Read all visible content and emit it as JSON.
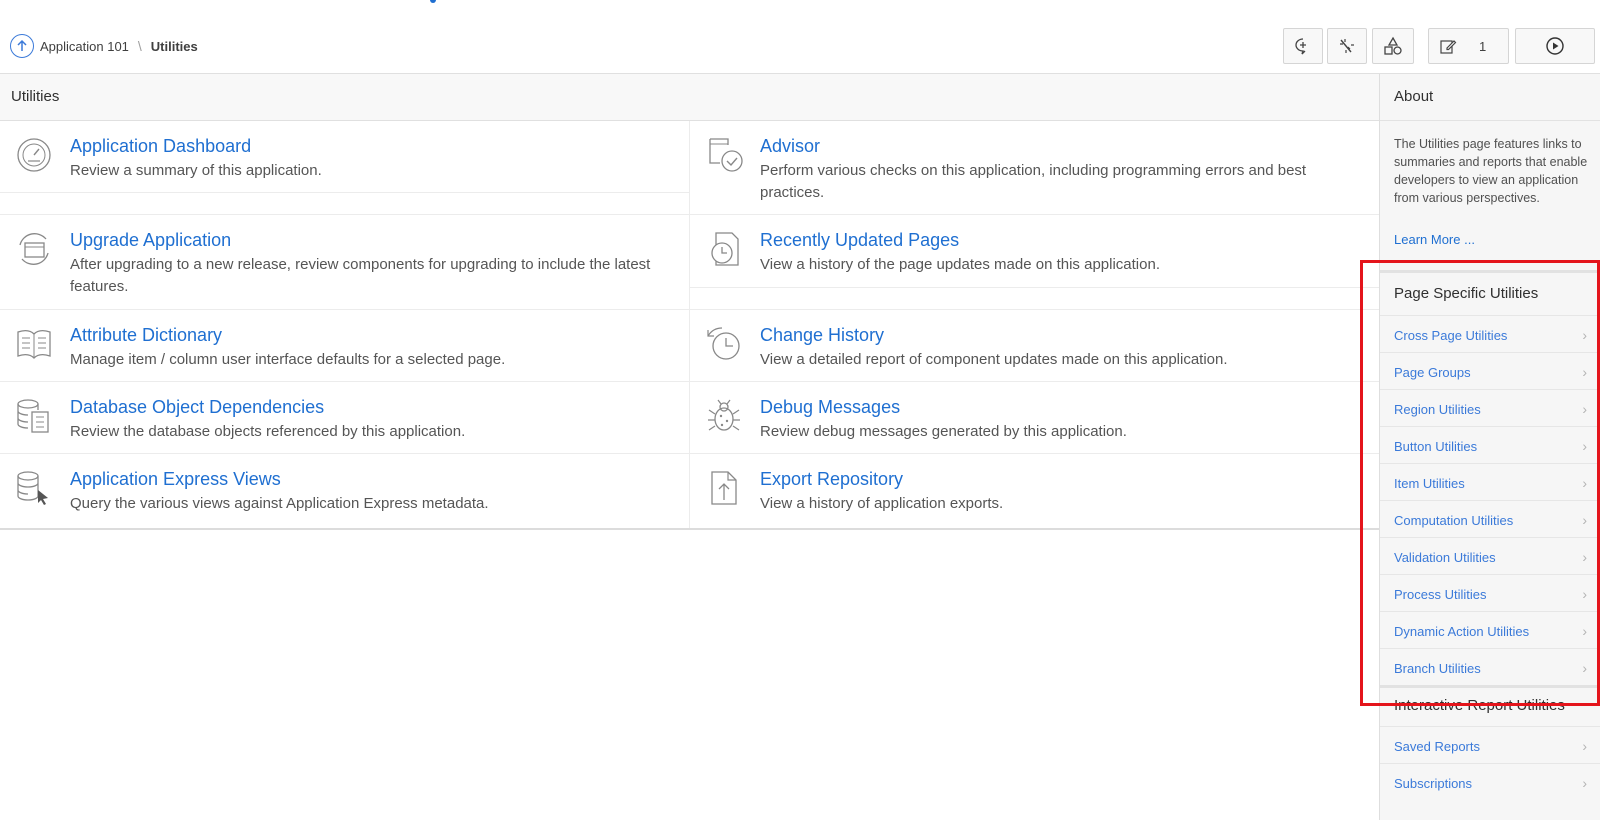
{
  "breadcrumb": {
    "app": "Application 101",
    "separator": "\\",
    "current": "Utilities"
  },
  "toolbar": {
    "edit_count": "1"
  },
  "main": {
    "header": "Utilities",
    "items": [
      {
        "title": "Application Dashboard",
        "desc": "Review a summary of this application.",
        "icon": "dashboard-gauge-icon"
      },
      {
        "title": "Advisor",
        "desc": "Perform various checks on this application, including programming errors and best practices.",
        "icon": "advisor-check-icon"
      },
      {
        "title": "Upgrade Application",
        "desc": "After upgrading to a new release, review components for upgrading to include the latest features.",
        "icon": "upgrade-refresh-icon"
      },
      {
        "title": "Recently Updated Pages",
        "desc": "View a history of the page updates made on this application.",
        "icon": "page-clock-icon"
      },
      {
        "title": "Attribute Dictionary",
        "desc": "Manage item / column user interface defaults for a selected page.",
        "icon": "open-book-icon"
      },
      {
        "title": "Change History",
        "desc": "View a detailed report of component updates made on this application.",
        "icon": "history-clock-icon"
      },
      {
        "title": "Database Object Dependencies",
        "desc": "Review the database objects referenced by this application.",
        "icon": "database-list-icon"
      },
      {
        "title": "Debug Messages",
        "desc": "Review debug messages generated by this application.",
        "icon": "bug-icon"
      },
      {
        "title": "Application Express Views",
        "desc": "Query the various views against Application Express metadata.",
        "icon": "database-cursor-icon"
      },
      {
        "title": "Export Repository",
        "desc": "View a history of application exports.",
        "icon": "file-export-icon"
      }
    ]
  },
  "sidebar": {
    "about_title": "About",
    "about_text": "The Utilities page features links to summaries and reports that enable developers to view an application from various perspectives.",
    "learn_more": "Learn More ...",
    "page_specific_title": "Page Specific Utilities",
    "page_specific_items": [
      "Cross Page Utilities",
      "Page Groups",
      "Region Utilities",
      "Button Utilities",
      "Item Utilities",
      "Computation Utilities",
      "Validation Utilities",
      "Process Utilities",
      "Dynamic Action Utilities",
      "Branch Utilities"
    ],
    "ir_title": "Interactive Report Utilities",
    "ir_items": [
      "Saved Reports",
      "Subscriptions"
    ]
  },
  "colors": {
    "link": "#1f6fd1",
    "highlight": "#e4141b"
  }
}
